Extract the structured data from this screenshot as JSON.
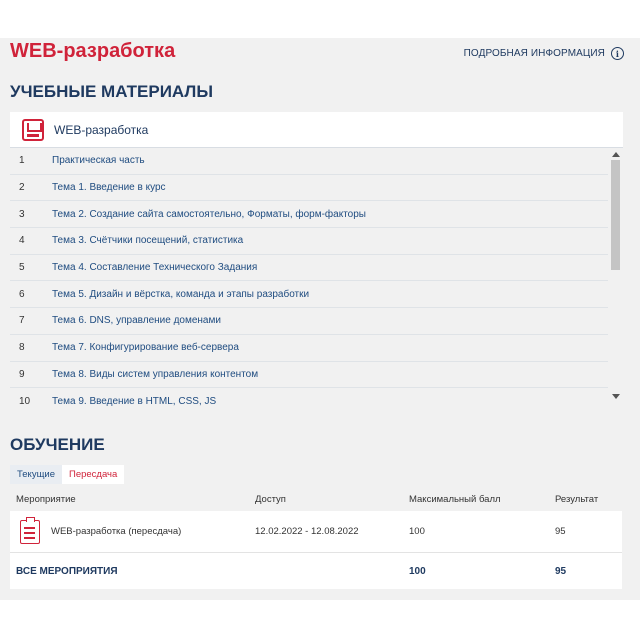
{
  "header": {
    "title": "WEB-разработка",
    "info_link": "ПОДРОБНАЯ ИНФОРМАЦИЯ",
    "info_icon": "info-circle-icon"
  },
  "materials": {
    "heading": "УЧЕБНЫЕ МАТЕРИАЛЫ",
    "panel_title": "WEB-разработка",
    "panel_icon": "floppy-book-icon",
    "items": [
      {
        "num": "1",
        "label": "Практическая часть"
      },
      {
        "num": "2",
        "label": "Тема 1. Введение в курс"
      },
      {
        "num": "3",
        "label": "Тема 2. Создание сайта самостоятельно, Форматы, форм-факторы"
      },
      {
        "num": "4",
        "label": "Тема 3. Счётчики посещений, статистика"
      },
      {
        "num": "5",
        "label": "Тема 4. Составление Технического Задания"
      },
      {
        "num": "6",
        "label": "Тема 5. Дизайн и вёрстка, команда и этапы разработки"
      },
      {
        "num": "7",
        "label": "Тема 6. DNS, управление доменами"
      },
      {
        "num": "8",
        "label": "Тема 7. Конфигурирование веб-сервера"
      },
      {
        "num": "9",
        "label": "Тема 8. Виды систем управления контентом"
      },
      {
        "num": "10",
        "label": "Тема 9. Введение в HTML, CSS, JS"
      }
    ]
  },
  "training": {
    "heading": "ОБУЧЕНИЕ",
    "tabs": {
      "current": "Текущие",
      "retake": "Пересдача"
    },
    "columns": {
      "event": "Мероприятие",
      "access": "Доступ",
      "max": "Максимальный балл",
      "result": "Результат"
    },
    "rows": [
      {
        "event": "WEB-разработка (пересдача)",
        "access": "12.02.2022 - 12.08.2022",
        "max": "100",
        "result": "95"
      }
    ],
    "footer": {
      "label": "ВСЕ МЕРОПРИЯТИЯ",
      "max": "100",
      "result": "95"
    }
  },
  "colors": {
    "accent": "#d0233a",
    "navy": "#1f3a60",
    "background": "#f1f1f1"
  }
}
